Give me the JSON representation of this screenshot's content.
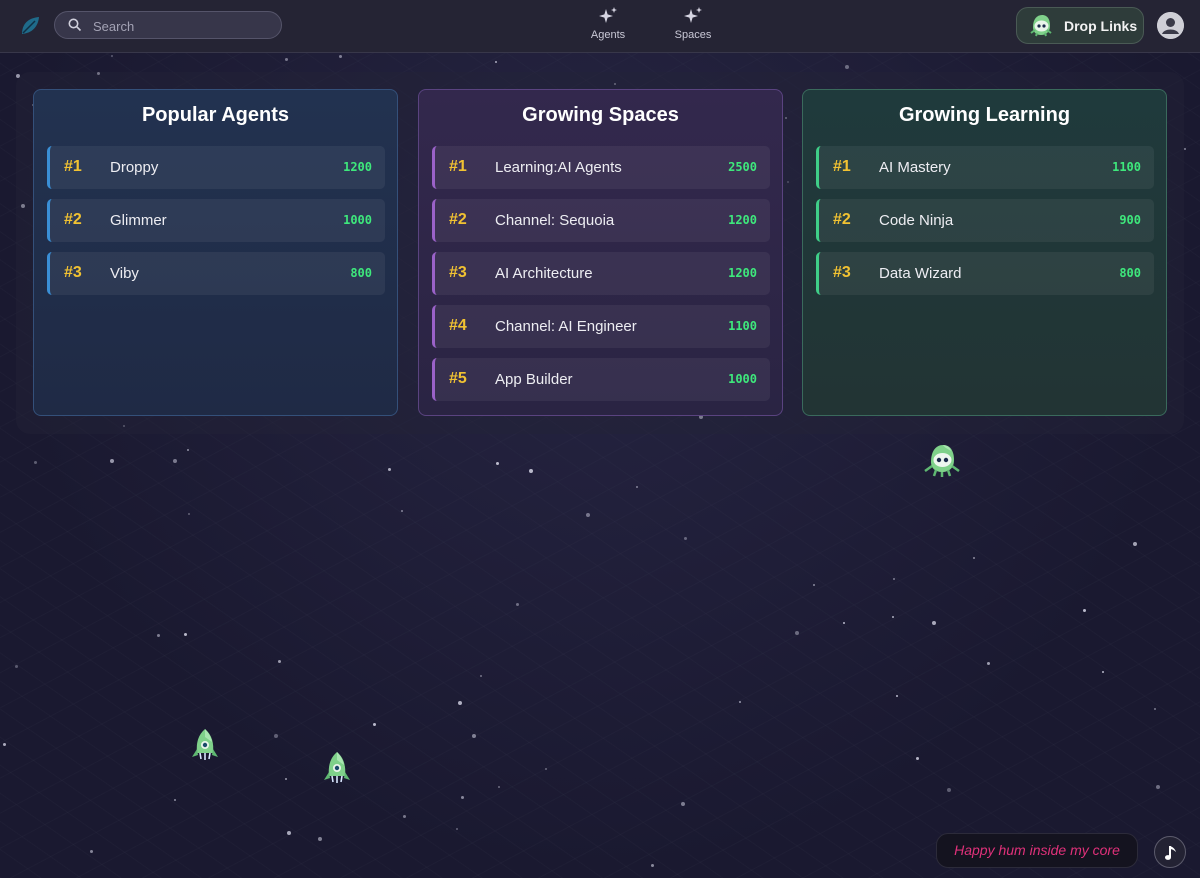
{
  "topbar": {
    "search_placeholder": "Search",
    "nav": [
      {
        "label": "Agents",
        "icon": "sparkles-icon"
      },
      {
        "label": "Spaces",
        "icon": "sparkles-icon"
      }
    ],
    "drop_links_label": "Drop Links"
  },
  "leaderboards": [
    {
      "title": "Popular Agents",
      "accent": "#3a8fd6",
      "items": [
        {
          "rank": "#1",
          "name": "Droppy",
          "score": "1200"
        },
        {
          "rank": "#2",
          "name": "Glimmer",
          "score": "1000"
        },
        {
          "rank": "#3",
          "name": "Viby",
          "score": "800"
        }
      ]
    },
    {
      "title": "Growing Spaces",
      "accent": "#9a62c8",
      "items": [
        {
          "rank": "#1",
          "name": "Learning:AI Agents",
          "score": "2500"
        },
        {
          "rank": "#2",
          "name": "Channel: Sequoia",
          "score": "1200"
        },
        {
          "rank": "#3",
          "name": "AI Architecture",
          "score": "1200"
        },
        {
          "rank": "#4",
          "name": "Channel: AI Engineer",
          "score": "1100"
        },
        {
          "rank": "#5",
          "name": "App Builder",
          "score": "1000"
        }
      ]
    },
    {
      "title": "Growing Learning",
      "accent": "#3fcf88",
      "items": [
        {
          "rank": "#1",
          "name": "AI Mastery",
          "score": "1100"
        },
        {
          "rank": "#2",
          "name": "Code Ninja",
          "score": "900"
        },
        {
          "rank": "#3",
          "name": "Data Wizard",
          "score": "800"
        }
      ]
    }
  ],
  "toast": {
    "text": "Happy hum inside my core"
  },
  "colors": {
    "rank": "#f1c232",
    "score": "#3ee87c",
    "toast": "#e0317a"
  }
}
